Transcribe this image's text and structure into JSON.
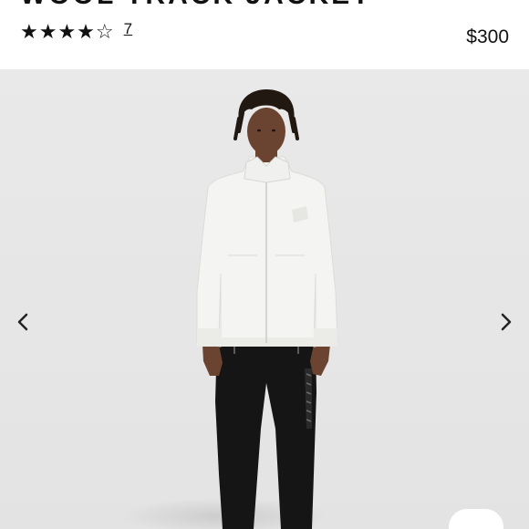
{
  "product": {
    "title": "WOOL TRACK JACKET",
    "rating_stars": "★★★★☆",
    "review_count": "7",
    "price": "$300"
  },
  "gallery": {
    "image_subject": "product-photo-model-white-track-jacket-black-pants",
    "prev_icon": "chevron-left-icon",
    "next_icon": "chevron-right-icon"
  },
  "colors": {
    "background": "#e6e6e6",
    "jacket": "#f4f4f2",
    "pants": "#151515",
    "text": "#111111"
  }
}
